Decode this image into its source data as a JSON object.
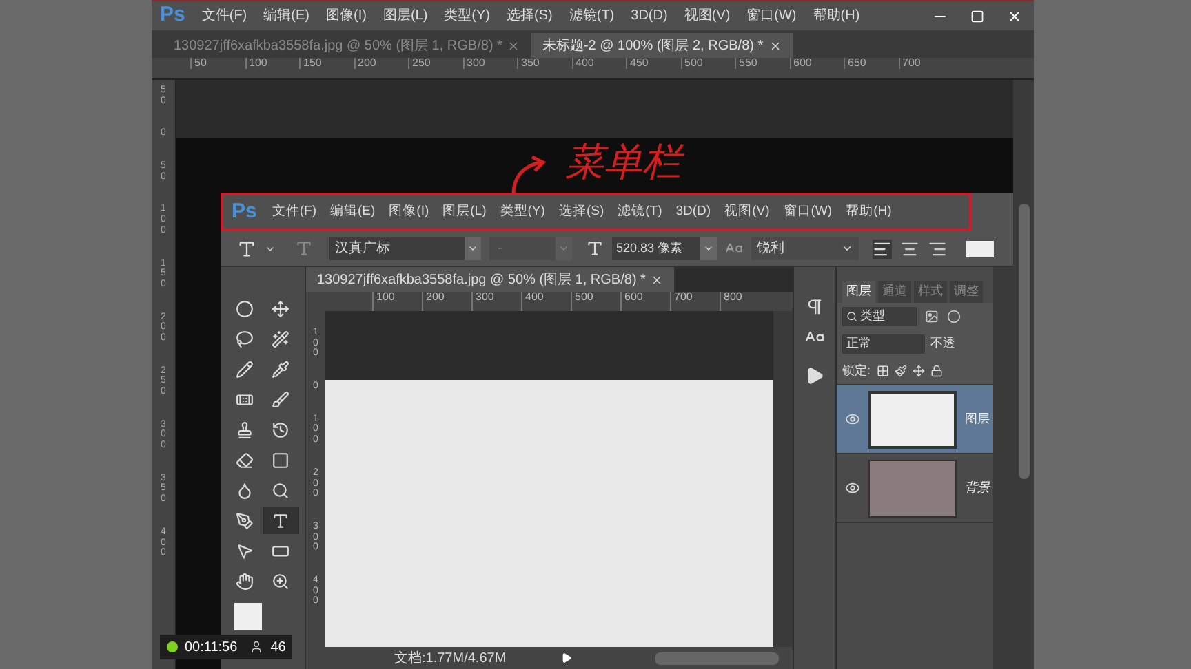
{
  "outer_window": {
    "logo": "Ps",
    "menu": [
      "文件(F)",
      "编辑(E)",
      "图像(I)",
      "图层(L)",
      "类型(Y)",
      "选择(S)",
      "滤镜(T)",
      "3D(D)",
      "视图(V)",
      "窗口(W)",
      "帮助(H)"
    ],
    "tabs": [
      {
        "label": "130927jff6xafkba3558fa.jpg @ 50% (图层 1, RGB/8) *",
        "selected": false
      },
      {
        "label": "未标题-2 @ 100% (图层 2, RGB/8) *",
        "selected": true
      }
    ],
    "h_ruler": [
      "50",
      "100",
      "150",
      "200",
      "250",
      "300",
      "350",
      "400",
      "450",
      "500",
      "550",
      "600",
      "650",
      "700"
    ],
    "v_ruler": [
      "50",
      "0",
      "50",
      "100",
      "150",
      "200",
      "250",
      "300",
      "350",
      "400"
    ]
  },
  "annotation": {
    "text": "菜单栏"
  },
  "inner_window": {
    "logo": "Ps",
    "menu": [
      "文件(F)",
      "编辑(E)",
      "图像(I)",
      "图层(L)",
      "类型(Y)",
      "选择(S)",
      "滤镜(T)",
      "3D(D)",
      "视图(V)",
      "窗口(W)",
      "帮助(H)"
    ],
    "options_bar": {
      "font_family": "汉真广标",
      "font_style": "-",
      "font_size": "520.83 像素",
      "antialias": "锐利"
    },
    "tab": {
      "label": "130927jff6xafkba3558fa.jpg @ 50% (图层 1, RGB/8) *"
    },
    "h_ruler": [
      "100",
      "200",
      "300",
      "400",
      "500",
      "600",
      "700",
      "800"
    ],
    "v_ruler": [
      "100",
      "0",
      "100",
      "200",
      "300",
      "400"
    ],
    "tools": [
      {
        "kind": "marquee",
        "selected": false
      },
      {
        "kind": "move",
        "selected": false
      },
      {
        "kind": "lasso",
        "selected": false
      },
      {
        "kind": "wand",
        "selected": false
      },
      {
        "kind": "pen-brush",
        "selected": false
      },
      {
        "kind": "eyedropper",
        "selected": false
      },
      {
        "kind": "bandage",
        "selected": false
      },
      {
        "kind": "brush",
        "selected": false
      },
      {
        "kind": "stamp",
        "selected": false
      },
      {
        "kind": "history",
        "selected": false
      },
      {
        "kind": "eraser",
        "selected": false
      },
      {
        "kind": "gradient",
        "selected": false
      },
      {
        "kind": "smudge",
        "selected": false
      },
      {
        "kind": "dodge",
        "selected": false
      },
      {
        "kind": "pen",
        "selected": false
      },
      {
        "kind": "type",
        "selected": true
      },
      {
        "kind": "select",
        "selected": false
      },
      {
        "kind": "shape",
        "selected": false
      },
      {
        "kind": "hand",
        "selected": false
      },
      {
        "kind": "zoom",
        "selected": false
      }
    ],
    "layers_panel": {
      "tabs": [
        {
          "label": "图层",
          "selected": true
        },
        {
          "label": "通道",
          "selected": false
        },
        {
          "label": "样式",
          "selected": false
        },
        {
          "label": "调整",
          "selected": false
        }
      ],
      "filter": "类型",
      "blend": "正常",
      "opacity_label": "不透",
      "lock_label": "锁定:",
      "layers": [
        {
          "name": "图层",
          "kind": "blank",
          "selected": true
        },
        {
          "name": "背景",
          "kind": "photo",
          "selected": false
        }
      ]
    },
    "status": "文档:1.77M/4.67M"
  },
  "recorder": {
    "time": "00:11:56",
    "count": "46"
  }
}
